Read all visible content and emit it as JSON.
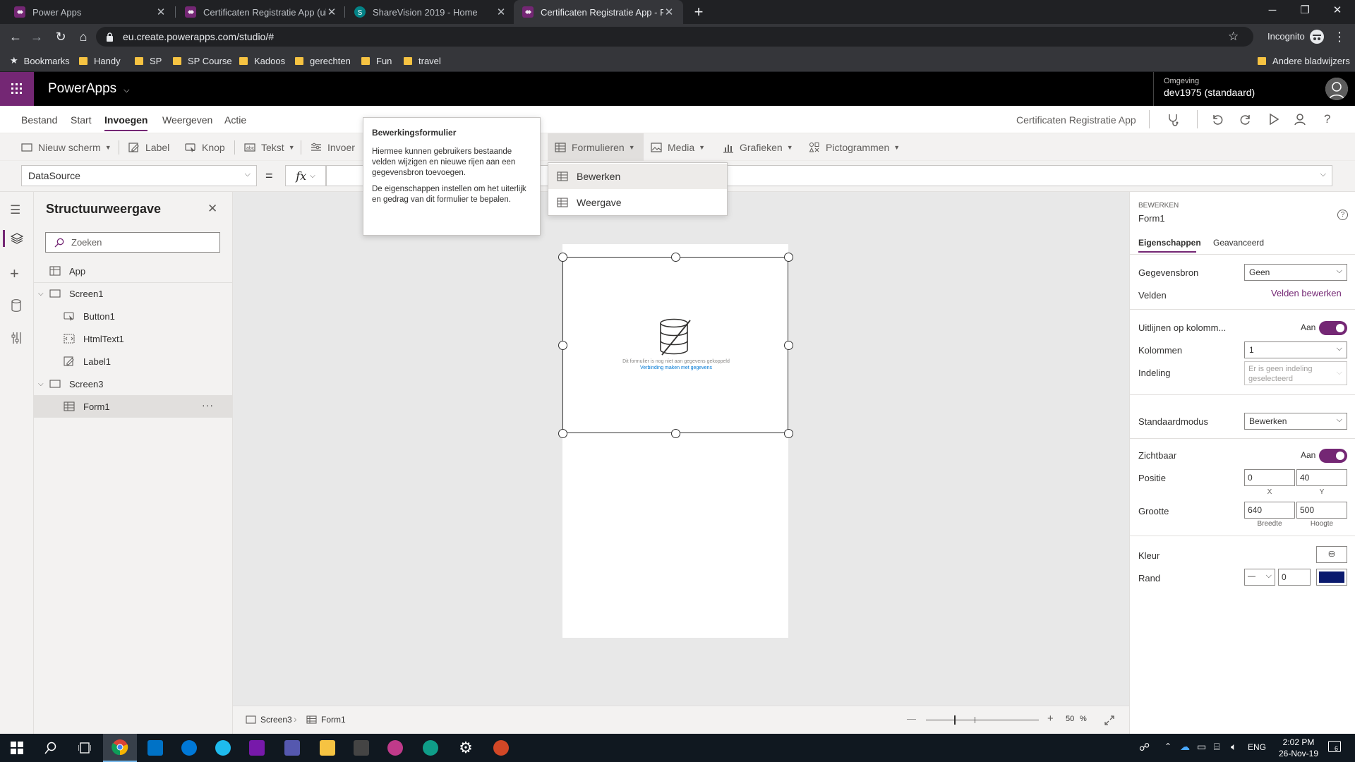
{
  "browser": {
    "tabs": [
      {
        "title": "Power Apps",
        "active": false
      },
      {
        "title": "Certificaten Registratie App (uitg",
        "active": false
      },
      {
        "title": "ShareVision 2019 - Home",
        "active": false
      },
      {
        "title": "Certificaten Registratie App - Pov",
        "active": true
      }
    ],
    "url": "eu.create.powerapps.com/studio/#",
    "profile": "Incognito",
    "bookmarks": [
      "Bookmarks",
      "Handy",
      "SP",
      "SP Course",
      "Kadoos",
      "gerechten",
      "Fun",
      "travel"
    ],
    "other_bookmarks": "Andere bladwijzers"
  },
  "header": {
    "app_name": "PowerApps",
    "env_label": "Omgeving",
    "env_value": "dev1975 (standaard)"
  },
  "menu": {
    "items": [
      "Bestand",
      "Start",
      "Invoegen",
      "Weergeven",
      "Actie"
    ],
    "selected": "Invoegen",
    "app_title": "Certificaten Registratie App"
  },
  "ribbon": {
    "new_screen": "Nieuw scherm",
    "label": "Label",
    "button": "Knop",
    "text": "Tekst",
    "input": "Invoer",
    "forms": "Formulieren",
    "media": "Media",
    "charts": "Grafieken",
    "icons": "Pictogrammen"
  },
  "formula": {
    "property": "DataSource",
    "equals": "=",
    "fx": "fx",
    "value": ""
  },
  "tooltip": {
    "title": "Bewerkingsformulier",
    "p1": "Hiermee kunnen gebruikers bestaande velden wijzigen en nieuwe rijen aan een gegevensbron toevoegen.",
    "p2": "De eigenschappen instellen om het uiterlijk en gedrag van dit formulier te bepalen."
  },
  "forms_menu": {
    "items": [
      "Bewerken",
      "Weergave"
    ]
  },
  "tree": {
    "title": "Structuurweergave",
    "search_placeholder": "Zoeken",
    "nodes": [
      {
        "label": "App",
        "level": 0
      },
      {
        "label": "Screen1",
        "level": 0
      },
      {
        "label": "Button1",
        "level": 1
      },
      {
        "label": "HtmlText1",
        "level": 1
      },
      {
        "label": "Label1",
        "level": 1
      },
      {
        "label": "Screen3",
        "level": 0
      },
      {
        "label": "Form1",
        "level": 1
      }
    ],
    "more": "···"
  },
  "canvas": {
    "form_message": "Dit formulier is nog niet aan gegevens gekoppeld",
    "form_link": "Verbinding maken met gegevens"
  },
  "status": {
    "screen": "Screen3",
    "control": "Form1",
    "minus": "—",
    "plus": "+",
    "zoom": "50",
    "zoom_unit": "%"
  },
  "props": {
    "type_label": "BEWERKEN",
    "control_name": "Form1",
    "tabs": [
      "Eigenschappen",
      "Geavanceerd"
    ],
    "datasource_label": "Gegevensbron",
    "datasource_value": "Geen",
    "fields_label": "Velden",
    "fields_link": "Velden bewerken",
    "snap_label": "Uitlijnen op kolomm...",
    "snap_value": "Aan",
    "columns_label": "Kolommen",
    "columns_value": "1",
    "layout_label": "Indeling",
    "layout_value": "Er is geen indeling geselecteerd",
    "mode_label": "Standaardmodus",
    "mode_value": "Bewerken",
    "visible_label": "Zichtbaar",
    "visible_value": "Aan",
    "position_label": "Positie",
    "pos_x": "0",
    "pos_y": "40",
    "x_cap": "X",
    "y_cap": "Y",
    "size_label": "Grootte",
    "width": "640",
    "height": "500",
    "width_cap": "Breedte",
    "height_cap": "Hoogte",
    "color_label": "Kleur",
    "border_label": "Rand",
    "border_width": "0",
    "border_color": "#0a1a6e"
  },
  "taskbar": {
    "time": "2:02 PM",
    "date": "26-Nov-19",
    "lang": "ENG",
    "notif_count": "6"
  },
  "colors": {
    "accent": "#742774",
    "chrome_dark": "#202124",
    "chrome_tab": "#35363a"
  }
}
